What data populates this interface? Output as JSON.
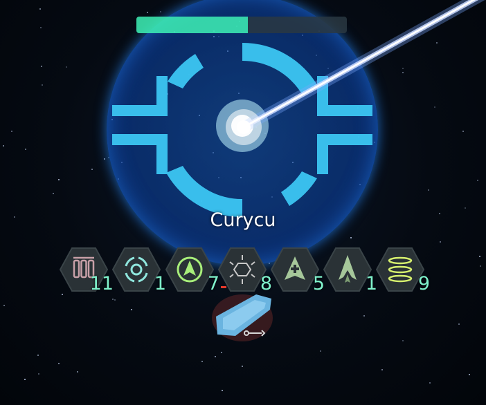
{
  "game": {
    "health_percent": 53,
    "health_color": "#3ef2b6",
    "shield_color": "#1e7fe0",
    "target_name": "Curycu",
    "target_icon": "shield-emblem-icon",
    "abilities": [
      {
        "icon": "missile-pods-icon",
        "count": "11",
        "color": "#c8a0a8"
      },
      {
        "icon": "ring-scan-icon",
        "count": "1",
        "color": "#8fe6dd"
      },
      {
        "icon": "fighter-arrow-icon",
        "count": "7",
        "color": "#a8ee7a"
      },
      {
        "icon": "hex-burst-icon",
        "count": "8",
        "color": "#c9c9c9"
      },
      {
        "icon": "repair-ship-icon",
        "count": "5",
        "color": "#a6c79a"
      },
      {
        "icon": "flame-thruster-icon",
        "count": "1",
        "color": "#a6c79a"
      },
      {
        "icon": "stacked-rings-icon",
        "count": "9",
        "color": "#d6f06e"
      }
    ],
    "player_ship_icon": "player-ship-icon",
    "repair_indicator_icon": "wrench-icon"
  }
}
